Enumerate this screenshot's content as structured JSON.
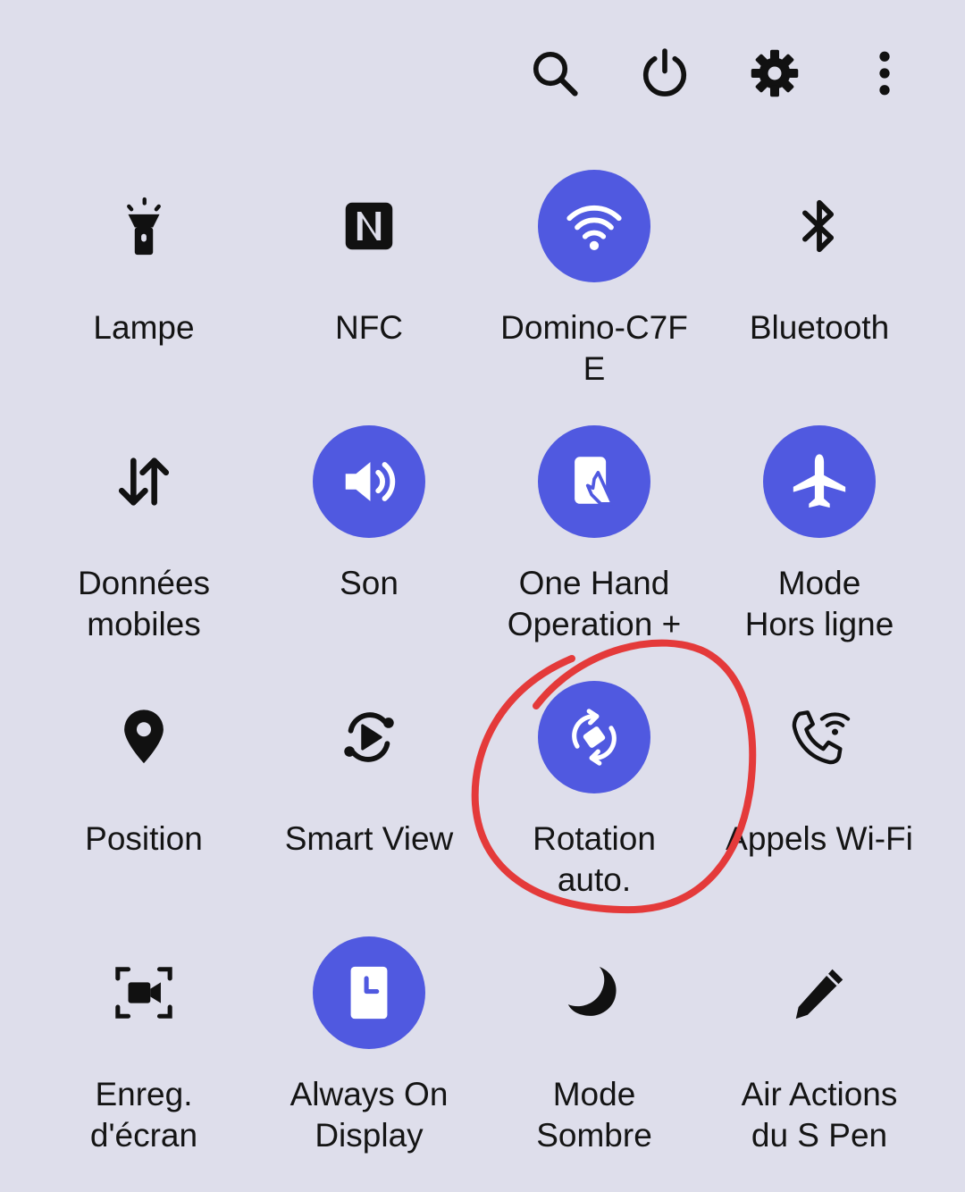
{
  "header": {
    "buttons": [
      {
        "id": "search",
        "icon": "search-icon"
      },
      {
        "id": "power",
        "icon": "power-icon"
      },
      {
        "id": "settings",
        "icon": "gear-icon"
      },
      {
        "id": "more",
        "icon": "more-vertical-icon"
      }
    ]
  },
  "colors": {
    "background": "#dedeeb",
    "accent": "#5059e0",
    "annotation": "#e43a3a"
  },
  "tiles": [
    {
      "label": "Lampe",
      "icon": "flashlight-icon",
      "active": false
    },
    {
      "label": "NFC",
      "icon": "nfc-icon",
      "active": false
    },
    {
      "label": "Domino-C7F\nE",
      "icon": "wifi-icon",
      "active": true
    },
    {
      "label": "Bluetooth",
      "icon": "bluetooth-icon",
      "active": false
    },
    {
      "label": "Données\nmobiles",
      "icon": "mobile-data-icon",
      "active": false
    },
    {
      "label": "Son",
      "icon": "sound-icon",
      "active": true
    },
    {
      "label": "One Hand\nOperation +",
      "icon": "one-hand-icon",
      "active": true
    },
    {
      "label": "Mode\nHors ligne",
      "icon": "airplane-icon",
      "active": true
    },
    {
      "label": "Position",
      "icon": "location-icon",
      "active": false
    },
    {
      "label": "Smart View",
      "icon": "smart-view-icon",
      "active": false
    },
    {
      "label": "Rotation\nauto.",
      "icon": "auto-rotate-icon",
      "active": true
    },
    {
      "label": "Appels Wi-Fi",
      "icon": "wifi-calling-icon",
      "active": false
    },
    {
      "label": "Enreg.\nd'écran",
      "icon": "screen-record-icon",
      "active": false
    },
    {
      "label": "Always On\nDisplay",
      "icon": "always-on-display-icon",
      "active": true
    },
    {
      "label": "Mode\nSombre",
      "icon": "moon-icon",
      "active": false
    },
    {
      "label": "Air Actions\ndu S Pen",
      "icon": "pen-icon",
      "active": false
    }
  ]
}
